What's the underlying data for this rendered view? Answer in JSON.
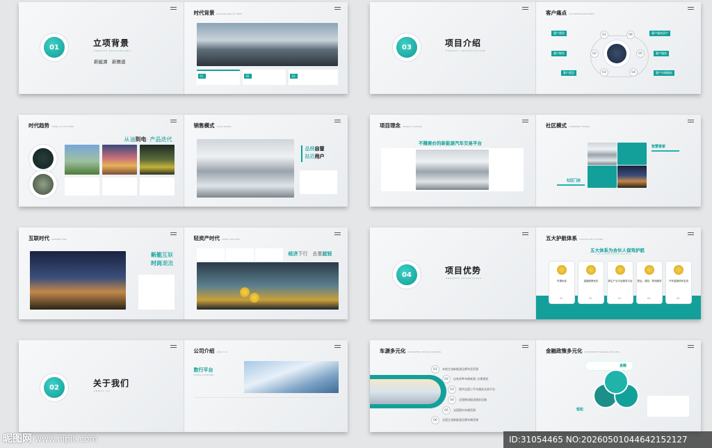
{
  "s1": {
    "cover_num": "01",
    "cover_title": "立项背景",
    "cover_sub": "PROJECT BACKGROUND",
    "cover_tags": "新能源　新赛道",
    "right_title": "时代背景",
    "right_en": "BACKGROUND OF TIMES",
    "nums": [
      "01",
      "02",
      "03"
    ]
  },
  "s2": {
    "cover_num": "03",
    "cover_title": "项目介绍",
    "cover_sub": "PROJECT INTRODUCTION",
    "right_title": "客户痛点",
    "right_en": "CUSTOMER PAIN POINTS",
    "nodes": [
      "01",
      "02",
      "03",
      "04",
      "05",
      "06"
    ],
    "tags": [
      "客户类别",
      "客户购车",
      "客户类型",
      "客户服务资产",
      "客户服务",
      "客户车辆服务"
    ]
  },
  "s3": {
    "left_title": "时代趋势",
    "left_en": "TREND OF THE TIMES",
    "slogan_a": "从油",
    "slogan_b": "到电",
    "slogan_c": "· 产品迭代",
    "right_title": "销售模式",
    "right_en": "SALES MODEL",
    "brand_a": "品牌",
    "brand_b": "自营",
    "brand_c": "贴近",
    "brand_d": "用户"
  },
  "s4": {
    "left_title": "项目理念",
    "left_en": "PROJECT CONCEPT",
    "headline": "不赚差价的新能源汽车交易平台",
    "right_title": "社区模式",
    "right_en": "COMMUNITY MODEL",
    "label_a": "智慧管家",
    "label_b": "社区门店"
  },
  "s5": {
    "left_title": "互联时代",
    "left_en": "INTERNET ERA",
    "slogan_a": "新能",
    "slogan_b": "互联",
    "slogan_c": "时尚",
    "slogan_d": "潮流",
    "right_title": "轻资产时代",
    "right_en": "ASSET LIGHT ERA",
    "econ_a": "经济",
    "econ_b": "下行",
    "econ_c": "去重",
    "econ_d": "就轻"
  },
  "s6": {
    "cover_num": "04",
    "cover_title": "项目优势",
    "cover_sub": "PROJECT ADVANTAGES",
    "right_title": "五大护航体系",
    "right_en": "FIVE ESCORT SYSTEMS",
    "headline": "五大体系为合伙人保驾护航",
    "headline_en": "FIVE SYSTEMS ESCORT PARTNERS",
    "cards": [
      "车源优化",
      "金融政策优化",
      "新生产业平台服务平台",
      "售后、保险、物流服务",
      "汽车金融体系支持"
    ],
    "card_nums": [
      "01",
      "02",
      "03",
      "04",
      "05"
    ]
  },
  "s7": {
    "cover_num": "02",
    "cover_title": "关于我们",
    "cover_sub": "ABOUT US",
    "right_title": "公司介绍",
    "right_en": "ABOUT US",
    "platform": "数行平台",
    "platform_en": "DIGITAL PLATFORM"
  },
  "s8": {
    "left_title": "车源多元化",
    "left_en": "DIVERSIFIED VEHICLE SOURCES",
    "nodes": [
      "01",
      "02",
      "03",
      "04",
      "05",
      "06"
    ],
    "items": [
      "本地主流新能源品牌车型资源",
      "自有多种车辆来源, 价格便宜",
      "提供全国二手车服务交易平台",
      "全国物流配送服务设施",
      "全国国内车辆资源",
      "全国主流新能源品牌车辆资源"
    ],
    "right_title": "金融政策多元化",
    "right_en": "DIVERSIFIED FINANCIAL POLICIES",
    "fin_a": "金融",
    "fin_b": "轻松"
  },
  "watermark": {
    "logo": "昵图网",
    "url": "www.nipic.com",
    "id": "ID:31054465 NO:20260501044642152127"
  },
  "colors": {
    "accent": "#13a09a",
    "accent_light": "#1fb3aa"
  }
}
